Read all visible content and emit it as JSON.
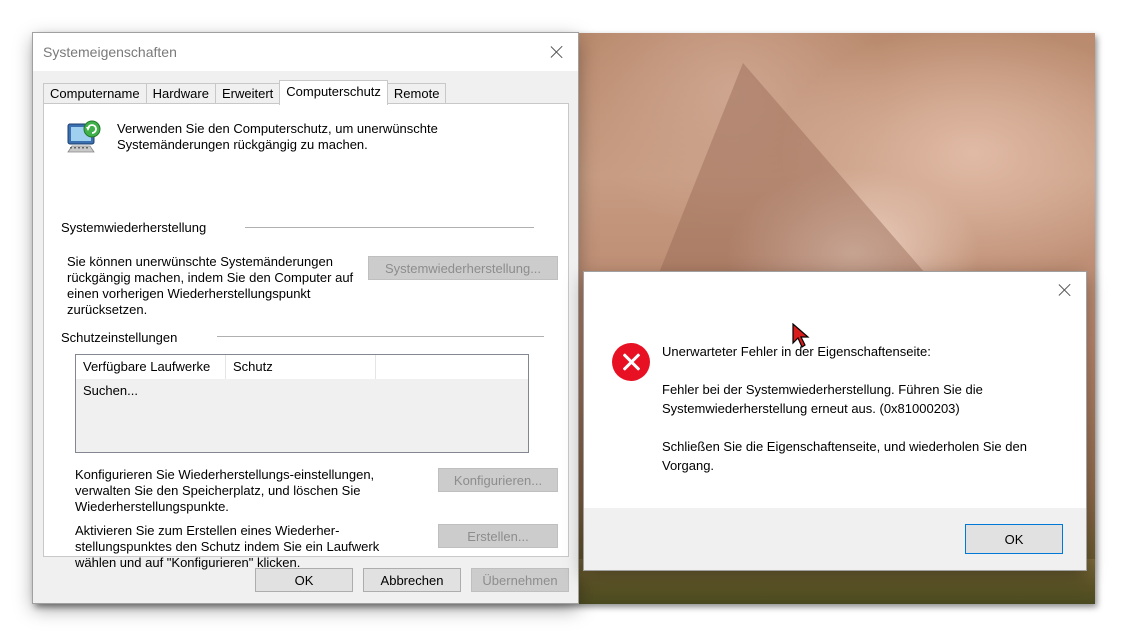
{
  "sysprops": {
    "title": "Systemeigenschaften",
    "tabs": [
      {
        "label": "Computername"
      },
      {
        "label": "Hardware"
      },
      {
        "label": "Erweitert"
      },
      {
        "label": "Computerschutz"
      },
      {
        "label": "Remote"
      }
    ],
    "active_tab": "Computerschutz",
    "intro": "Verwenden Sie den Computerschutz, um unerwünschte Systemänderungen rückgängig zu machen.",
    "restore": {
      "heading": "Systemwiederherstellung",
      "text": "Sie können unerwünschte Systemänderungen rückgängig machen, indem Sie den Computer auf einen vorherigen Wiederherstellungspunkt zurücksetzen.",
      "button": "Systemwiederherstellung..."
    },
    "protection": {
      "heading": "Schutzeinstellungen",
      "columns": [
        "Verfügbare Laufwerke",
        "Schutz"
      ],
      "status": "Suchen...",
      "configure_text": "Konfigurieren Sie Wiederherstellungs-einstellungen, verwalten Sie den Speicherplatz, und löschen Sie Wiederherstellungspunkte.",
      "configure_button": "Konfigurieren...",
      "create_text": "Aktivieren Sie zum Erstellen eines Wiederher-stellungspunktes den Schutz indem Sie ein Laufwerk wählen und auf \"Konfigurieren\" klicken.",
      "create_button": "Erstellen..."
    },
    "buttons": {
      "ok": "OK",
      "cancel": "Abbrechen",
      "apply": "Übernehmen"
    }
  },
  "error_dialog": {
    "line1": "Unerwarteter Fehler in der Eigenschaftenseite:",
    "line2": "Fehler bei der Systemwiederherstellung. Führen Sie die Systemwiederherstellung erneut aus. (0x81000203)",
    "line3": " Schließen Sie die Eigenschaftenseite, und wiederholen Sie den Vorgang.",
    "ok": "OK",
    "icon": "error-icon",
    "icon_color": "#e81123"
  }
}
